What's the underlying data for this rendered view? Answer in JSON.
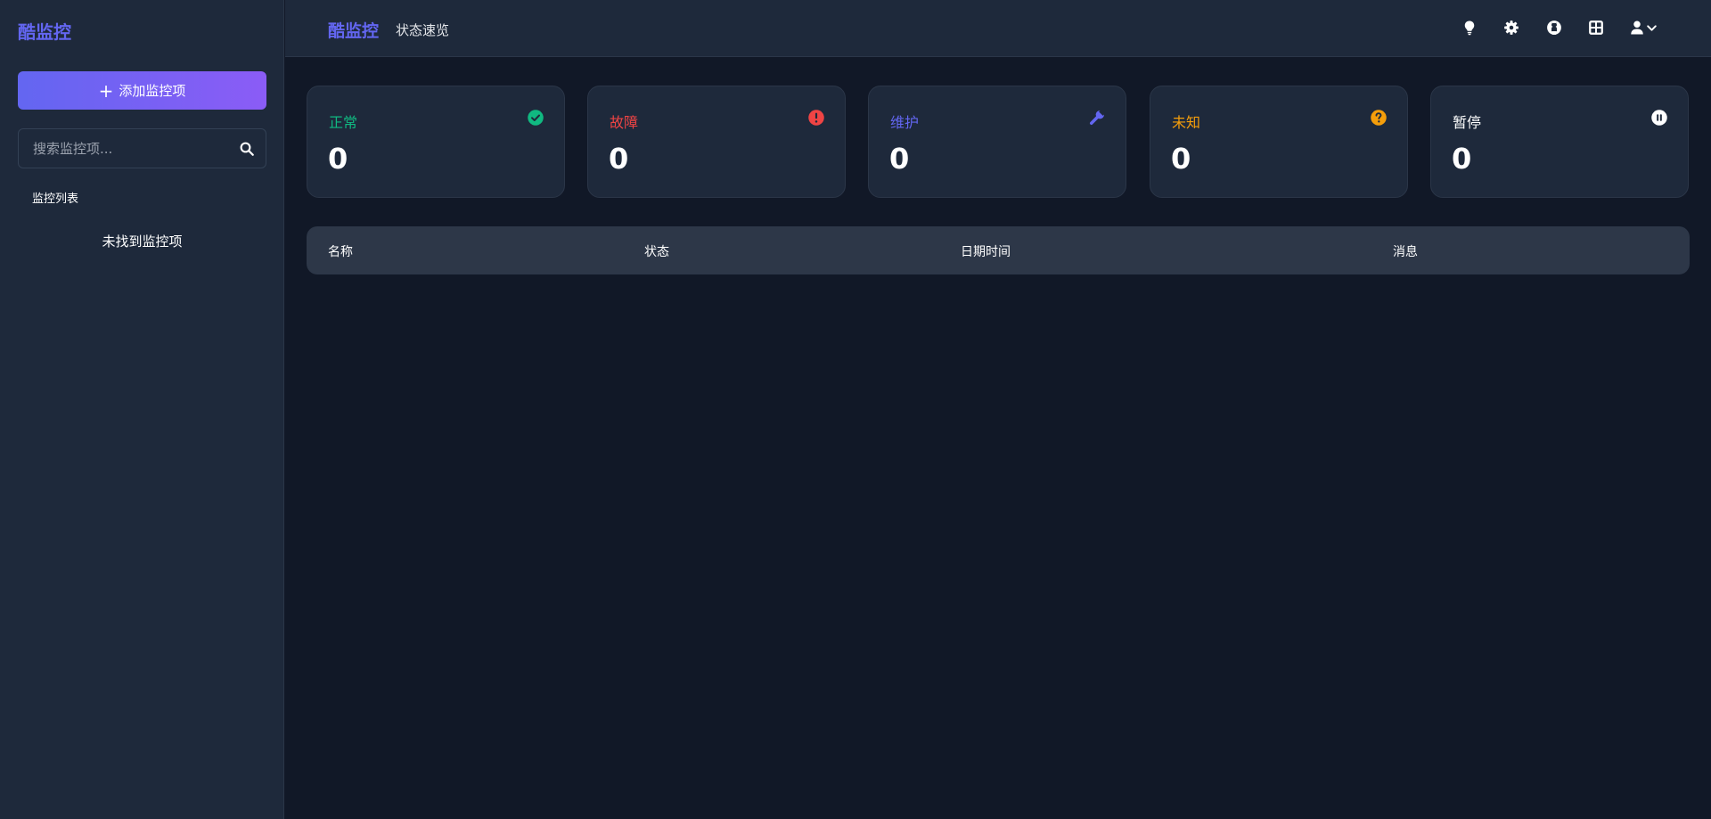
{
  "sidebar": {
    "logo": "酷监控",
    "add_button_label": "添加监控项",
    "add_button_icon": "plus-icon",
    "search_placeholder": "搜索监控项...",
    "search_icon": "search-icon",
    "list_title": "监控列表",
    "empty_text": "未找到监控项"
  },
  "header": {
    "logo": "酷监控",
    "subtitle": "状态速览",
    "icons": [
      "lightbulb-icon",
      "gear-icon",
      "github-icon",
      "grid-icon",
      "user-icon",
      "chevron-down-icon"
    ]
  },
  "stats": [
    {
      "label": "正常",
      "value": "0",
      "color": "#10b981",
      "icon": "check-circle-icon"
    },
    {
      "label": "故障",
      "value": "0",
      "color": "#ef4444",
      "icon": "exclamation-circle-icon"
    },
    {
      "label": "维护",
      "value": "0",
      "color": "#6366f1",
      "icon": "wrench-icon"
    },
    {
      "label": "未知",
      "value": "0",
      "color": "#f59e0b",
      "icon": "question-circle-icon"
    },
    {
      "label": "暂停",
      "value": "0",
      "color": "#ffffff",
      "icon": "pause-circle-icon"
    }
  ],
  "table": {
    "columns": [
      "名称",
      "状态",
      "日期时间",
      "消息"
    ]
  },
  "colors": {
    "background": "#111827",
    "panel": "#1e293b",
    "accent": "#6366f1",
    "accent_end": "#8b5cf6",
    "table_header": "#2d3748"
  }
}
